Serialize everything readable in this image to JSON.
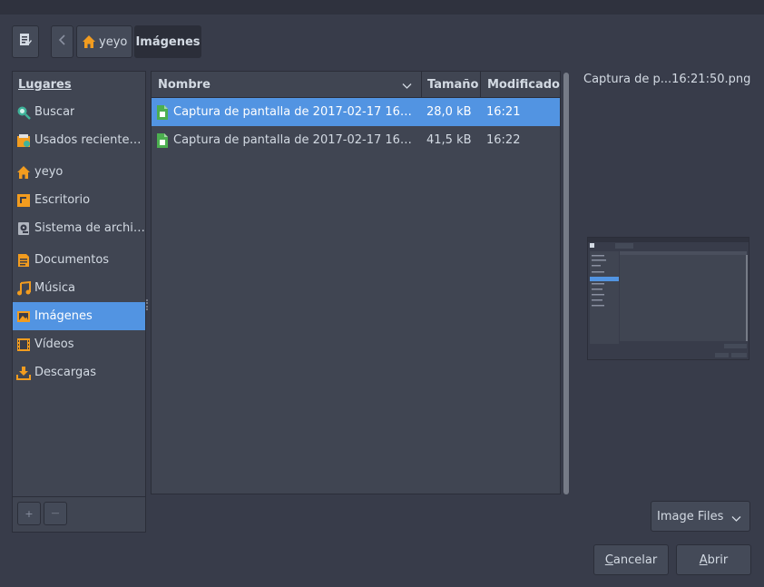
{
  "toolbar": {
    "edit_icon": "edit-location-icon",
    "back_icon": "chevron-left-icon",
    "path": [
      {
        "label": "yeyo",
        "icon": "home-icon"
      },
      {
        "label": "Imágenes"
      }
    ]
  },
  "sidebar": {
    "heading": "Lugares",
    "items": [
      {
        "label": "Buscar",
        "icon": "search-icon"
      },
      {
        "label": "Usados reciente…",
        "icon": "recent-icon"
      },
      {
        "label": "yeyo",
        "icon": "home-icon"
      },
      {
        "label": "Escritorio",
        "icon": "desktop-icon"
      },
      {
        "label": "Sistema de archi…",
        "icon": "drive-icon"
      },
      {
        "label": "Documentos",
        "icon": "documents-icon"
      },
      {
        "label": "Música",
        "icon": "music-icon"
      },
      {
        "label": "Imágenes",
        "icon": "pictures-icon",
        "selected": true
      },
      {
        "label": "Vídeos",
        "icon": "videos-icon"
      },
      {
        "label": "Descargas",
        "icon": "downloads-icon"
      }
    ],
    "add_label": "+",
    "remove_label": "—"
  },
  "filelist": {
    "columns": [
      "Nombre",
      "Tamaño",
      "Modificado"
    ],
    "rows": [
      {
        "name": "Captura de pantalla de 2017-02-17 16…",
        "size": "28,0 kB",
        "modified": "16:21",
        "selected": true
      },
      {
        "name": "Captura de pantalla de 2017-02-17 16…",
        "size": "41,5 kB",
        "modified": "16:22"
      }
    ]
  },
  "preview": {
    "filename": "Captura de p...16:21:50.png"
  },
  "filter": {
    "label": "Image Files"
  },
  "buttons": {
    "cancel": {
      "mnemonic": "C",
      "rest": "ancelar"
    },
    "open": {
      "mnemonic": "A",
      "rest": "brir"
    }
  },
  "colors": {
    "background": "#383c4a",
    "panel": "#404552",
    "accent": "#5294e2",
    "folder_orange": "#f29c1f"
  }
}
